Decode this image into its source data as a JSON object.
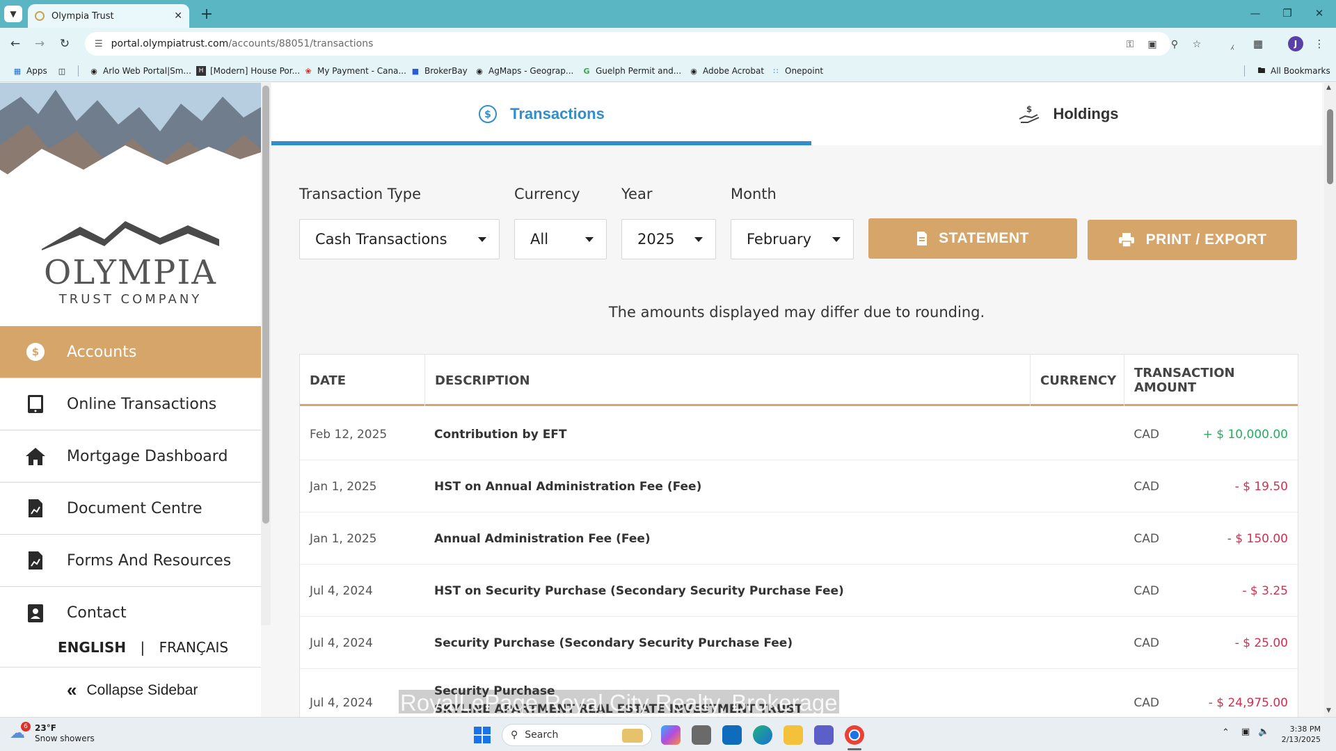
{
  "browser": {
    "tab_title": "Olympia Trust",
    "url_host": "portal.olympiatrust.com",
    "url_path": "/accounts/88051/transactions",
    "profile_initial": "J",
    "bookmarks": [
      "Apps",
      "Arlo Web Portal|Sm...",
      "[Modern] House Por...",
      "My Payment - Cana...",
      "BrokerBay",
      "AgMaps - Geograp...",
      "Guelph Permit and...",
      "Adobe Acrobat",
      "Onepoint"
    ],
    "all_bookmarks": "All Bookmarks"
  },
  "sidebar": {
    "logo_name": "OLYMPIA",
    "logo_sub": "TRUST COMPANY",
    "items": [
      {
        "label": "Accounts",
        "icon": "dollar-circle-icon",
        "active": true
      },
      {
        "label": "Online Transactions",
        "icon": "tablet-icon",
        "active": false
      },
      {
        "label": "Mortgage Dashboard",
        "icon": "home-icon",
        "active": false
      },
      {
        "label": "Document Centre",
        "icon": "document-chart-icon",
        "active": false
      },
      {
        "label": "Forms And Resources",
        "icon": "document-chart-icon",
        "active": false
      },
      {
        "label": "Contact",
        "icon": "contact-card-icon",
        "active": false
      }
    ],
    "lang_en": "ENGLISH",
    "lang_sep": "|",
    "lang_fr": "FRANÇAIS",
    "collapse_label": "Collapse Sidebar"
  },
  "main": {
    "tabs": [
      {
        "label": "Transactions",
        "active": true
      },
      {
        "label": "Holdings",
        "active": false
      }
    ],
    "filters": {
      "transaction_type": {
        "label": "Transaction Type",
        "value": "Cash Transactions"
      },
      "currency": {
        "label": "Currency",
        "value": "All"
      },
      "year": {
        "label": "Year",
        "value": "2025"
      },
      "month": {
        "label": "Month",
        "value": "February"
      }
    },
    "statement_button": "STATEMENT",
    "print_button": "PRINT / EXPORT",
    "note": "The amounts displayed may differ due to rounding.",
    "table": {
      "headers": [
        "DATE",
        "DESCRIPTION",
        "CURRENCY",
        "TRANSACTION AMOUNT"
      ],
      "rows": [
        {
          "date": "Feb 12, 2025",
          "description": "Contribution by EFT",
          "currency": "CAD",
          "amount": "+ $ 10,000.00",
          "sign": "pos"
        },
        {
          "date": "Jan 1, 2025",
          "description": "HST on Annual Administration Fee (Fee)",
          "currency": "CAD",
          "amount": "- $ 19.50",
          "sign": "neg"
        },
        {
          "date": "Jan 1, 2025",
          "description": "Annual Administration Fee (Fee)",
          "currency": "CAD",
          "amount": "- $ 150.00",
          "sign": "neg"
        },
        {
          "date": "Jul 4, 2024",
          "description": "HST on Security Purchase (Secondary Security Purchase Fee)",
          "currency": "CAD",
          "amount": "- $ 3.25",
          "sign": "neg"
        },
        {
          "date": "Jul 4, 2024",
          "description": "Security Purchase (Secondary Security Purchase Fee)",
          "currency": "CAD",
          "amount": "- $ 25.00",
          "sign": "neg"
        },
        {
          "date": "Jul 4, 2024",
          "description": "Security Purchase",
          "description2": "SKYLINE APARTMENT REAL ESTATE INVESTMENT TRUST",
          "currency": "CAD",
          "amount": "- $ 24,975.00",
          "sign": "neg"
        }
      ]
    },
    "watermark": "RoyalLePage Royal City Realty, Brokerage"
  },
  "taskbar": {
    "weather_badge": "6",
    "temperature": "23°F",
    "condition": "Snow showers",
    "search_placeholder": "Search",
    "time": "3:38 PM",
    "date": "2/13/2025"
  },
  "colors": {
    "accent_gold": "#d6a56a",
    "accent_blue": "#2f8ecb",
    "positive": "#27ae60",
    "negative": "#d32f4f",
    "browser_frame": "#5bb6c4"
  }
}
